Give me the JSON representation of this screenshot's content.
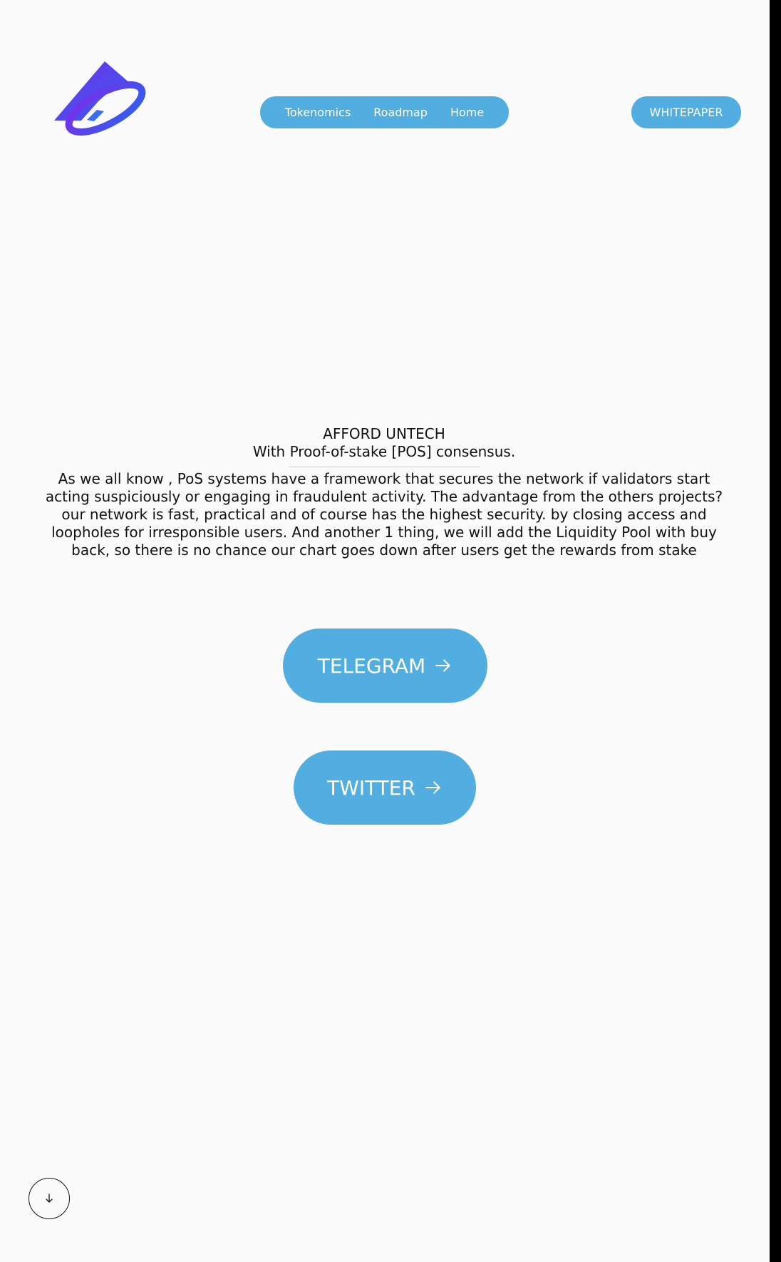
{
  "nav": {
    "items": [
      {
        "label": "Tokenomics"
      },
      {
        "label": "Roadmap"
      },
      {
        "label": "Home"
      }
    ],
    "whitepaper_label": "WHITEPAPER"
  },
  "hero": {
    "title": "AFFORD UNTECH",
    "subtitle": "With Proof-of-stake [POS] consensus.",
    "body": "As we all know , PoS systems have a framework that secures the network if validators start acting suspiciously or engaging in fraudulent activity. The advantage from the others projects? our network is fast, practical and of course has the highest security. by closing access and loopholes for irresponsible users. And another 1 thing, we will add the Liquidity Pool with buy back, so there is no chance our chart goes down after users get the rewards from stake"
  },
  "cta": {
    "telegram_label": "TELEGRAM",
    "twitter_label": "TWITTER"
  },
  "icons": {
    "logo": "arrow-up-orbit-logo",
    "cta_arrow": "arrow-right-icon",
    "scroll": "arrow-down-icon"
  },
  "colors": {
    "accent": "#52ade0",
    "logo_gradient_start": "#6a2ee8",
    "logo_gradient_end": "#2b6ff0",
    "background": "#fbfbfb"
  }
}
